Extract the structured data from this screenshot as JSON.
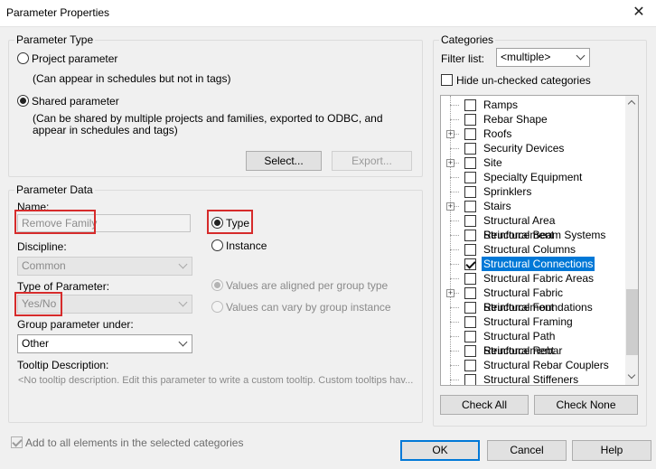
{
  "window": {
    "title": "Parameter Properties",
    "close_glyph": "✕"
  },
  "parameter_type": {
    "label": "Parameter Type",
    "project": {
      "label": "Project parameter",
      "description": "(Can appear in schedules but not in tags)",
      "checked": false
    },
    "shared": {
      "label": "Shared parameter",
      "description_line1": "(Can be shared by multiple projects and families, exported to ODBC, and",
      "description_line2": "appear in schedules and tags)",
      "checked": true
    },
    "select_button": "Select...",
    "export_button": "Export..."
  },
  "parameter_data": {
    "label": "Parameter Data",
    "name_label": "Name:",
    "name_value": "Remove Family",
    "discipline_label": "Discipline:",
    "discipline_value": "Common",
    "type_of_parameter_label": "Type of Parameter:",
    "type_of_parameter_value": "Yes/No",
    "group_label": "Group parameter under:",
    "group_value": "Other",
    "tooltip_label": "Tooltip Description:",
    "tooltip_value": "<No tooltip description. Edit this parameter to write a custom tooltip. Custom tooltips hav...",
    "type_radio": {
      "label": "Type",
      "checked": true
    },
    "instance_radio": {
      "label": "Instance",
      "checked": false
    },
    "aligned_radio": {
      "label": "Values are aligned per group type",
      "checked": true
    },
    "vary_radio": {
      "label": "Values can vary by group instance",
      "checked": false
    }
  },
  "add_to_all": {
    "label": "Add to all elements in the selected categories",
    "checked": true
  },
  "categories": {
    "label": "Categories",
    "filter_label": "Filter list:",
    "filter_value": "<multiple>",
    "hide_unchecked_label": "Hide un-checked categories",
    "items": [
      {
        "label": "Ramps",
        "expandable": false,
        "checked": false,
        "selected": false
      },
      {
        "label": "Rebar Shape",
        "expandable": false,
        "checked": false,
        "selected": false
      },
      {
        "label": "Roofs",
        "expandable": true,
        "checked": false,
        "selected": false
      },
      {
        "label": "Security Devices",
        "expandable": false,
        "checked": false,
        "selected": false
      },
      {
        "label": "Site",
        "expandable": true,
        "checked": false,
        "selected": false
      },
      {
        "label": "Specialty Equipment",
        "expandable": false,
        "checked": false,
        "selected": false
      },
      {
        "label": "Sprinklers",
        "expandable": false,
        "checked": false,
        "selected": false
      },
      {
        "label": "Stairs",
        "expandable": true,
        "checked": false,
        "selected": false
      },
      {
        "label": "Structural Area Reinforcement",
        "expandable": false,
        "checked": false,
        "selected": false
      },
      {
        "label": "Structural Beam Systems",
        "expandable": false,
        "checked": false,
        "selected": false
      },
      {
        "label": "Structural Columns",
        "expandable": false,
        "checked": false,
        "selected": false
      },
      {
        "label": "Structural Connections",
        "expandable": false,
        "checked": true,
        "selected": true
      },
      {
        "label": "Structural Fabric Areas",
        "expandable": false,
        "checked": false,
        "selected": false
      },
      {
        "label": "Structural Fabric Reinforcement",
        "expandable": true,
        "checked": false,
        "selected": false
      },
      {
        "label": "Structural Foundations",
        "expandable": false,
        "checked": false,
        "selected": false
      },
      {
        "label": "Structural Framing",
        "expandable": false,
        "checked": false,
        "selected": false
      },
      {
        "label": "Structural Path Reinforcement",
        "expandable": false,
        "checked": false,
        "selected": false
      },
      {
        "label": "Structural Rebar",
        "expandable": false,
        "checked": false,
        "selected": false
      },
      {
        "label": "Structural Rebar Couplers",
        "expandable": false,
        "checked": false,
        "selected": false
      },
      {
        "label": "Structural Stiffeners",
        "expandable": false,
        "checked": false,
        "selected": false
      }
    ],
    "check_all": "Check All",
    "check_none": "Check None"
  },
  "footer": {
    "ok": "OK",
    "cancel": "Cancel",
    "help": "Help"
  }
}
